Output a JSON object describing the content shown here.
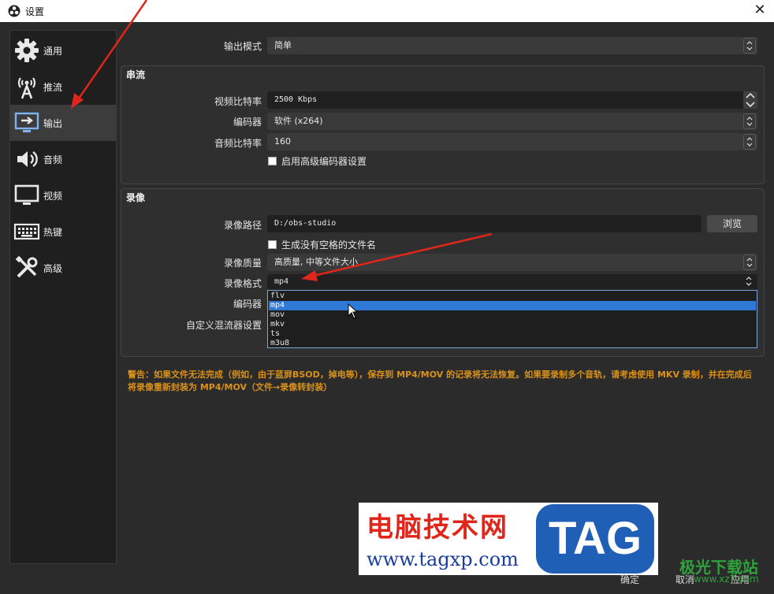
{
  "window": {
    "title": "设置",
    "close_glyph": "✕",
    "app_icon": "obs-logo-icon"
  },
  "sidebar": {
    "items": [
      {
        "label": "通用",
        "icon": "gear-icon"
      },
      {
        "label": "推流",
        "icon": "broadcast-icon"
      },
      {
        "label": "输出",
        "icon": "output-icon",
        "active": true
      },
      {
        "label": "音频",
        "icon": "speaker-icon"
      },
      {
        "label": "视频",
        "icon": "monitor-icon"
      },
      {
        "label": "热键",
        "icon": "keyboard-icon"
      },
      {
        "label": "高级",
        "icon": "tools-icon"
      }
    ]
  },
  "output_mode": {
    "label": "输出模式",
    "value": "简单"
  },
  "streaming": {
    "title": "串流",
    "video_bitrate": {
      "label": "视频比特率",
      "value": "2500 Kbps"
    },
    "encoder": {
      "label": "编码器",
      "value": "软件 (x264)"
    },
    "audio_bitrate": {
      "label": "音频比特率",
      "value": "160"
    },
    "advanced_checkbox": "启用高级编码器设置"
  },
  "recording": {
    "title": "录像",
    "path": {
      "label": "录像路径",
      "value": "D:/obs-studio",
      "browse": "浏览"
    },
    "no_space_checkbox": "生成没有空格的文件名",
    "quality": {
      "label": "录像质量",
      "value": "高质量, 中等文件大小"
    },
    "format": {
      "label": "录像格式",
      "value": "mp4",
      "options": [
        "flv",
        "mp4",
        "mov",
        "mkv",
        "ts",
        "m3u8"
      ],
      "selected": "mp4"
    },
    "encoder_label": "编码器",
    "muxer_label": "自定义混流器设置"
  },
  "warning": "警告：如果文件无法完成（例如，由于蓝屏BSOD，掉电等），保存到 MP4/MOV 的记录将无法恢复。如果要录制多个音轨，请考虑使用 MKV 录制，并在完成后将录像重新封装为 MP4/MOV（文件→录像转封装）",
  "footer": {
    "ok": "确定",
    "cancel": "取消",
    "apply": "应用"
  },
  "watermark": {
    "title": "电脑技术网",
    "url": "www.tagxp.com",
    "tag": "TAG",
    "site2": "极光下载站",
    "site2_url": "www.xz7.com"
  },
  "colors": {
    "accent": "#2f79d6",
    "warning": "#d9911a",
    "arrow": "#e0261b"
  }
}
